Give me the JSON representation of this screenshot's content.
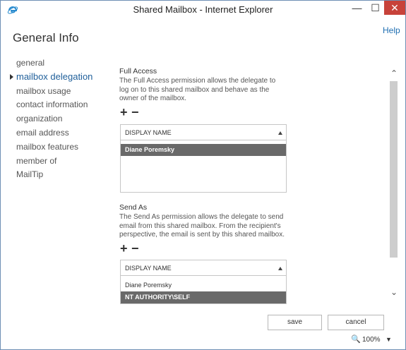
{
  "window": {
    "title": "Shared Mailbox - Internet Explorer",
    "min_glyph": "—",
    "max_glyph": "☐",
    "close_glyph": "✕"
  },
  "header": {
    "help": "Help",
    "page_title": "General Info"
  },
  "nav": {
    "items": [
      {
        "label": "general"
      },
      {
        "label": "mailbox delegation"
      },
      {
        "label": "mailbox usage"
      },
      {
        "label": "contact information"
      },
      {
        "label": "organization"
      },
      {
        "label": "email address"
      },
      {
        "label": "mailbox features"
      },
      {
        "label": "member of"
      },
      {
        "label": "MailTip"
      }
    ],
    "active_index": 1
  },
  "full_access": {
    "title": "Full Access",
    "description": "The Full Access permission allows the delegate to log on to this shared mailbox and behave as the owner of the mailbox.",
    "add": "+",
    "remove": "−",
    "column_header": "DISPLAY NAME",
    "rows": [
      {
        "name": "Diane Poremsky",
        "selected": true
      }
    ]
  },
  "send_as": {
    "title": "Send As",
    "description": "The Send As permission allows the delegate to send email from this shared mailbox. From the recipient's perspective, the email is sent by this shared mailbox.",
    "add": "+",
    "remove": "−",
    "column_header": "DISPLAY NAME",
    "rows": [
      {
        "name": "Diane Poremsky",
        "selected": false
      },
      {
        "name": "NT AUTHORITY\\SELF",
        "selected": true
      }
    ]
  },
  "buttons": {
    "save": "save",
    "cancel": "cancel"
  },
  "status": {
    "zoom": "100%",
    "zoom_icon": "🔍",
    "zoom_caret": "▼"
  },
  "scroll": {
    "up": "⌃",
    "down": "⌄"
  }
}
